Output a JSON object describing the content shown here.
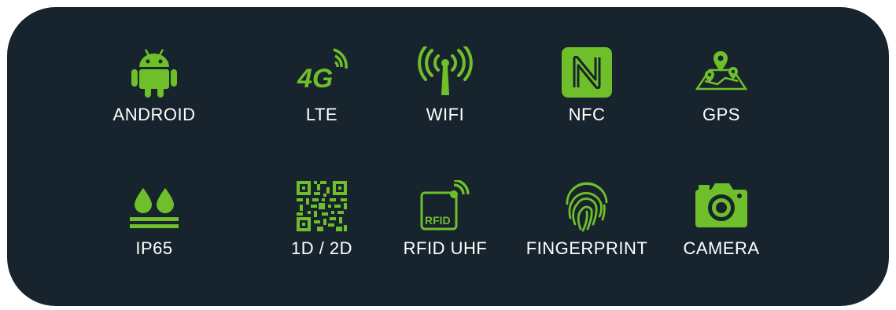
{
  "accent_color": "#6fbf2a",
  "background_color": "#17242d",
  "features": [
    {
      "label": "ANDROID",
      "icon": "android-icon"
    },
    {
      "label": "LTE",
      "icon": "4g-signal-icon",
      "icon_text": "4G"
    },
    {
      "label": "WIFI",
      "icon": "wifi-antenna-icon"
    },
    {
      "label": "NFC",
      "icon": "nfc-icon"
    },
    {
      "label": "GPS",
      "icon": "map-pin-icon"
    },
    {
      "label": "IP65",
      "icon": "water-drops-icon"
    },
    {
      "label": "1D / 2D",
      "icon": "qr-code-icon"
    },
    {
      "label": "RFID UHF",
      "icon": "rfid-icon",
      "icon_text": "RFID"
    },
    {
      "label": "FINGERPRINT",
      "icon": "fingerprint-icon"
    },
    {
      "label": "CAMERA",
      "icon": "camera-icon"
    }
  ]
}
